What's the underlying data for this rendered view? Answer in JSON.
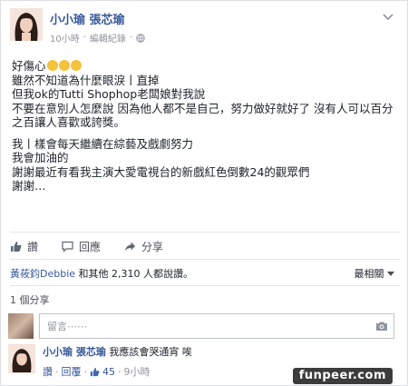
{
  "post": {
    "author": "小小瑜 張芯瑜",
    "time": "10小時",
    "edit_history": "編輯紀錄",
    "lines": [
      "好傷心",
      "雖然不知道為什麼眼淚丨直掉",
      "但我ok的Tutti Shophop老闆娘對我說",
      "不要在意別人怎麼說 因為他人都不是自己，努力做好就好了 沒有人可以百分之百讓人喜歡或誇獎。",
      "我丨樣會每天繼續在綜藝及戲劇努力",
      "我會加油的",
      "謝謝最近有看我主演大愛電視台的新戲紅色倒數24的觀眾們",
      "謝謝…"
    ]
  },
  "actions": {
    "like": "讚",
    "comment": "回應",
    "share": "分享"
  },
  "likes_line": {
    "names": "黃莜鈞Debbie",
    "rest": " 和其他 2,310 人都說讚。"
  },
  "sort_label": "最相關",
  "shares_count": "1 個分享",
  "comment_input": {
    "placeholder": "留言⋯⋯"
  },
  "reply": {
    "author": "小小瑜 張芯瑜",
    "message": "我應該會哭通宵 唉",
    "like": "讚",
    "reply": "回覆",
    "like_count": "45",
    "time": "9小時"
  },
  "watermark": "funpeer.com"
}
